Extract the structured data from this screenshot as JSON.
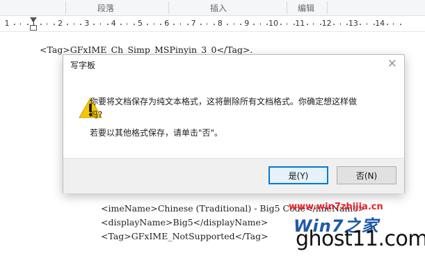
{
  "ribbon": {
    "groups": [
      "段落",
      "插入",
      "编辑"
    ]
  },
  "ruler": {
    "numbers": [
      "1",
      "1",
      "2",
      "3",
      "4",
      "5",
      "6",
      "7",
      "8",
      "9",
      "10",
      "11",
      "12",
      "13",
      "14"
    ]
  },
  "document": {
    "line_top": "<Tag>GFxIME_Ch_Simp_MSPinyin_3_0</Tag>.",
    "line_bottom_1": "<imeName>Chinese (Traditional) - Big5 Code</imeName>",
    "line_bottom_2": "<displayName>Big5</displayName>",
    "line_bottom_3": "<Tag>GFxIME_NotSupported</Tag>"
  },
  "dialog": {
    "title": "写字板",
    "close_glyph": "✕",
    "icon": "warning-icon",
    "message_line1": "你要将文档保存为纯文本格式，这将删除所有文档格式。你确定想这样做",
    "message_line2": "吗?",
    "message_secondary": "若要以其他格式保存，请单击\"否\"。",
    "yes_label": "是(Y)",
    "no_label": "否(N)"
  },
  "watermark": {
    "url": "www.win7zhijia.cn",
    "brand": "Win7之家",
    "site": "ghost11.com"
  },
  "colors": {
    "accent": "#0078d7",
    "warning": "#f7c600",
    "watermark_red": "#e8212b",
    "watermark_blue": "#1e5aa8"
  }
}
